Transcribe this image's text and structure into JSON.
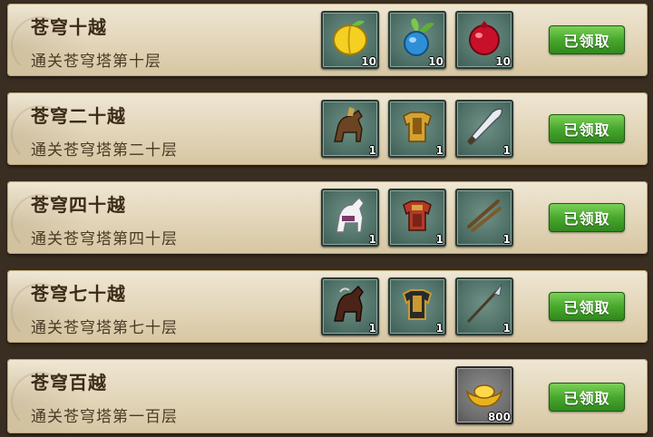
{
  "claim_button_label": "已领取",
  "rewards": [
    {
      "title": "苍穹十越",
      "desc": "通关苍穹塔第十层",
      "items": [
        {
          "icon": "yellow-fruit-icon",
          "qty": "10"
        },
        {
          "icon": "blue-radish-icon",
          "qty": "10"
        },
        {
          "icon": "red-pomegranate-icon",
          "qty": "10"
        }
      ]
    },
    {
      "title": "苍穹二十越",
      "desc": "通关苍穹塔第二十层",
      "items": [
        {
          "icon": "brown-warhorse-icon",
          "qty": "1"
        },
        {
          "icon": "gold-armor-icon",
          "qty": "1"
        },
        {
          "icon": "broad-blade-icon",
          "qty": "1"
        }
      ]
    },
    {
      "title": "苍穹四十越",
      "desc": "通关苍穹塔第四十层",
      "items": [
        {
          "icon": "white-horse-icon",
          "qty": "1"
        },
        {
          "icon": "red-armor-icon",
          "qty": "1"
        },
        {
          "icon": "crossed-sticks-icon",
          "qty": "1"
        }
      ]
    },
    {
      "title": "苍穹七十越",
      "desc": "通关苍穹塔第七十层",
      "items": [
        {
          "icon": "dark-horse-icon",
          "qty": "1"
        },
        {
          "icon": "black-gold-armor-icon",
          "qty": "1"
        },
        {
          "icon": "spear-icon",
          "qty": "1"
        }
      ]
    },
    {
      "title": "苍穹百越",
      "desc": "通关苍穹塔第一百层",
      "items": [
        {
          "icon": "gold-ingot-icon",
          "qty": "800"
        }
      ]
    }
  ]
}
